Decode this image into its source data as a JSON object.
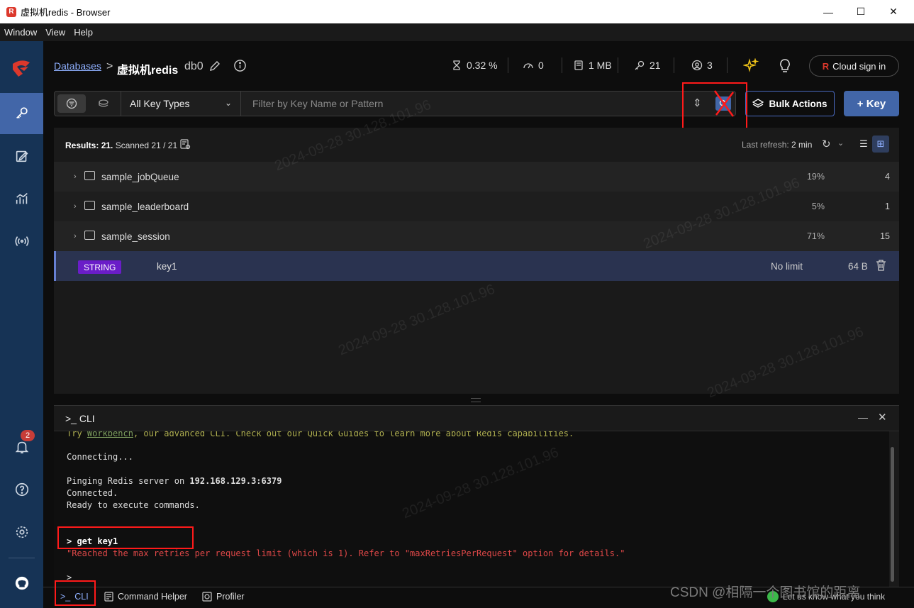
{
  "window": {
    "title": "虚拟机redis - Browser",
    "controls": {
      "minimize": "—",
      "maximize": "☐",
      "close": "✕"
    }
  },
  "menu": [
    "Window",
    "View",
    "Help"
  ],
  "sidebar": {
    "items": [
      {
        "name": "browser",
        "icon": "key-icon",
        "active": true
      },
      {
        "name": "workbench",
        "icon": "edit-icon"
      },
      {
        "name": "analysis",
        "icon": "chart-icon"
      },
      {
        "name": "pubsub",
        "icon": "broadcast-icon"
      }
    ],
    "notifications_count": "2",
    "bottom_icons": [
      "bell-icon",
      "help-icon",
      "settings-icon",
      "github-icon"
    ]
  },
  "header": {
    "breadcrumb_link": "Databases",
    "breadcrumb_sep": ">",
    "db_name": "虚拟机redis",
    "db_index": "db0",
    "stats": {
      "cpu": "0.32 %",
      "ops": "0",
      "memory": "1 MB",
      "keys": "21",
      "clients": "3"
    },
    "cloud_button": "Cloud sign in"
  },
  "filter": {
    "key_type": "All Key Types",
    "search_placeholder": "Filter by Key Name or Pattern",
    "bulk_actions": "Bulk Actions",
    "add_key": "+ Key"
  },
  "results": {
    "label": "Results:",
    "count": "21.",
    "scanned": "Scanned 21 / 21",
    "last_refresh_label": "Last refresh:",
    "last_refresh_value": "2 min",
    "folders": [
      {
        "name": "sample_jobQueue",
        "percent": "19%",
        "count": "4"
      },
      {
        "name": "sample_leaderboard",
        "percent": "5%",
        "count": "1"
      },
      {
        "name": "sample_session",
        "percent": "71%",
        "count": "15"
      }
    ],
    "key_row": {
      "type": "STRING",
      "name": "key1",
      "ttl": "No limit",
      "size": "64 B"
    }
  },
  "cli": {
    "title": "CLI",
    "lines": {
      "tip_pre": "Try ",
      "tip_link": "Workbench",
      "tip_post": ", our advanced CLI. Check out our Quick Guides to learn more about Redis capabilities.",
      "connecting": "Connecting...",
      "pinging_pre": "Pinging Redis server on ",
      "pinging_host": "192.168.129.3:6379",
      "connected": "Connected.",
      "ready": "Ready to execute commands.",
      "command": "> get key1",
      "error": "\"Reached the max retries per request limit (which is 1). Refer to \"maxRetriesPerRequest\" option for details.\"",
      "prompt": ">"
    }
  },
  "bottom_tabs": [
    "CLI",
    "Command Helper",
    "Profiler"
  ],
  "feedback": "Let us know what you think",
  "watermark_text": "2024-09-28 30.128.101.96",
  "csdn_mark": "CSDN @相隔一个图书馆的距离",
  "colors": {
    "accent": "#4266a8",
    "sidebar": "#163355",
    "string_badge": "#6a1dc8",
    "error": "#e04848"
  }
}
